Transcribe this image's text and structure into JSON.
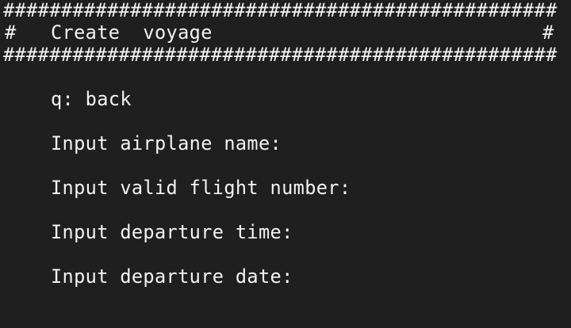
{
  "header": {
    "border": "################################################",
    "title_left_hash": "#",
    "title": "Create  voyage",
    "title_right_hash": "#"
  },
  "menu": {
    "back_option": "q: back"
  },
  "prompts": {
    "airplane_name": "Input airplane name:",
    "flight_number": "Input valid flight number:",
    "departure_time": "Input departure time:",
    "departure_date": "Input departure date:"
  },
  "colors": {
    "background": "#1f1f1f",
    "text": "#f2f2f2"
  }
}
